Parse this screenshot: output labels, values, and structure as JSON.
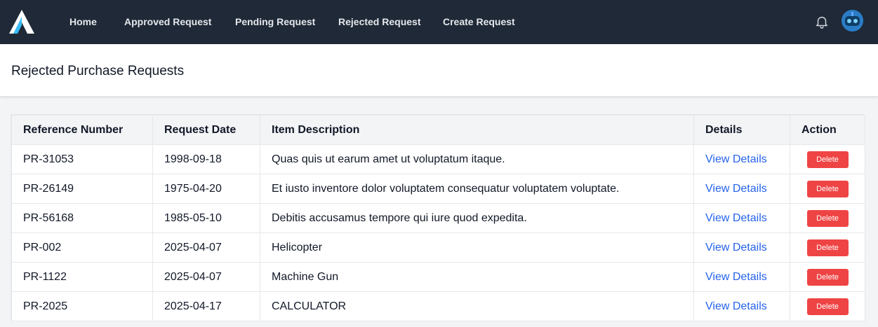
{
  "nav": {
    "links": [
      "Home",
      "Approved Request",
      "Pending Request",
      "Rejected Request",
      "Create Request"
    ]
  },
  "page": {
    "title": "Rejected Purchase Requests"
  },
  "table": {
    "headers": [
      "Reference Number",
      "Request Date",
      "Item Description",
      "Details",
      "Action"
    ],
    "rows": [
      {
        "ref": "PR-31053",
        "date": "1998-09-18",
        "desc": "Quas quis ut earum amet ut voluptatum itaque.",
        "details": "View Details",
        "action": "Delete"
      },
      {
        "ref": "PR-26149",
        "date": "1975-04-20",
        "desc": "Et iusto inventore dolor voluptatem consequatur voluptatem voluptate.",
        "details": "View Details",
        "action": "Delete"
      },
      {
        "ref": "PR-56168",
        "date": "1985-05-10",
        "desc": "Debitis accusamus tempore qui iure quod expedita.",
        "details": "View Details",
        "action": "Delete"
      },
      {
        "ref": "PR-002",
        "date": "2025-04-07",
        "desc": "Helicopter",
        "details": "View Details",
        "action": "Delete"
      },
      {
        "ref": "PR-1122",
        "date": "2025-04-07",
        "desc": "Machine Gun",
        "details": "View Details",
        "action": "Delete"
      },
      {
        "ref": "PR-2025",
        "date": "2025-04-17",
        "desc": "CALCULATOR",
        "details": "View Details",
        "action": "Delete"
      }
    ]
  },
  "colors": {
    "navbar": "#1f2937",
    "link": "#2563eb",
    "delete": "#ef4444"
  },
  "icons": {
    "logo": "logo-icon",
    "notifications": "bell-icon",
    "avatar": "robot-avatar-icon"
  }
}
